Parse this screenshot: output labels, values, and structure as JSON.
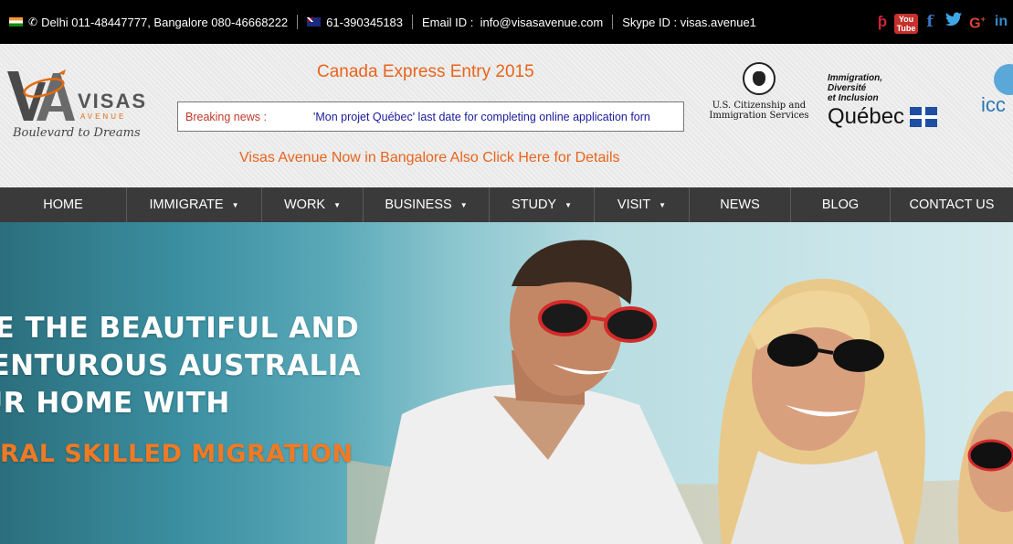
{
  "contact_bar": {
    "india_phones": "Delhi 011-48447777, Bangalore 080-46668222",
    "australia_phone": "61-390345183",
    "email_label": "Email ID :",
    "email": "info@visasavenue.com",
    "skype_label": "Skype ID :",
    "skype": "visas.avenue1",
    "youtube_text": "You Tube",
    "social_icons": [
      "pinterest-icon",
      "youtube-icon",
      "facebook-icon",
      "twitter-icon",
      "google-plus-icon",
      "linkedin-icon"
    ]
  },
  "logo": {
    "name": "VISAS",
    "sub": "AVENUE",
    "tagline": "Boulevard to Dreams"
  },
  "header": {
    "promo_title": "Canada Express Entry 2015",
    "breaking_label": "Breaking news :",
    "breaking_text": "'Mon projet Québec' last date for completing online application forn",
    "promo_link": "Visas Avenue Now in Bangalore Also Click Here for Details"
  },
  "partners": {
    "uscis_line1": "U.S. Citizenship and",
    "uscis_line2": "Immigration Services",
    "quebec_line1": "Immigration,",
    "quebec_line2": "Diversité",
    "quebec_line3": "et Inclusion",
    "quebec_name": "Québec",
    "iccrc": "icc"
  },
  "nav": {
    "items": [
      {
        "label": "HOME",
        "dropdown": false
      },
      {
        "label": "IMMIGRATE",
        "dropdown": true
      },
      {
        "label": "WORK",
        "dropdown": true
      },
      {
        "label": "BUSINESS",
        "dropdown": true
      },
      {
        "label": "STUDY",
        "dropdown": true
      },
      {
        "label": "VISIT",
        "dropdown": true
      },
      {
        "label": "NEWS",
        "dropdown": false
      },
      {
        "label": "BLOG",
        "dropdown": false
      },
      {
        "label": "CONTACT US",
        "dropdown": false
      }
    ]
  },
  "hero": {
    "line1": "KE THE BEAUTIFUL AND",
    "line2": "VENTUROUS AUSTRALIA",
    "line3": "UR HOME WITH",
    "line4": "NERAL SKILLED MIGRATION"
  },
  "colors": {
    "accent_orange": "#e8641b",
    "topbar_bg": "#000000",
    "nav_bg": "#3a3a3a",
    "breaking_label": "#c0392b",
    "breaking_text": "#1a1a9c"
  }
}
